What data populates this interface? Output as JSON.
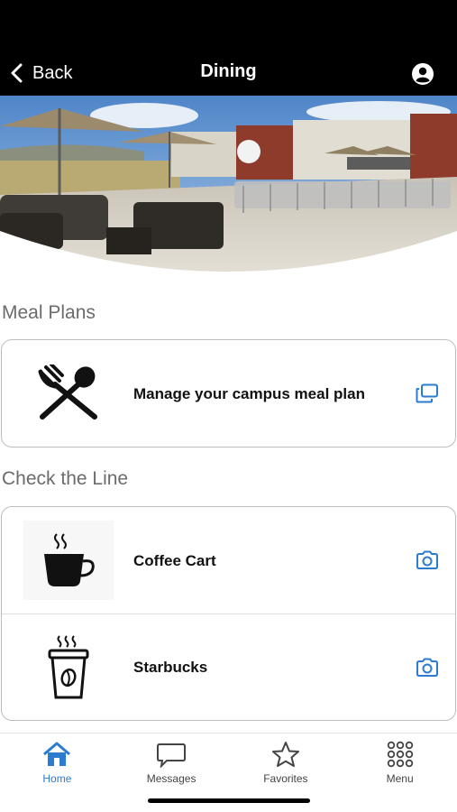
{
  "header": {
    "back_label": "Back",
    "title": "Dining",
    "profile_icon": "user-circle-icon"
  },
  "hero": {
    "alt": "Outdoor rooftop dining patio with umbrellas"
  },
  "meal_plans": {
    "section_title": "Meal Plans",
    "items": [
      {
        "label": "Manage your campus meal plan",
        "icon": "fork-spoon-icon",
        "action_icon": "external-window-icon"
      }
    ]
  },
  "check_line": {
    "section_title": "Check the Line",
    "items": [
      {
        "label": "Coffee Cart",
        "icon": "coffee-cup-icon",
        "action_icon": "camera-icon"
      },
      {
        "label": "Starbucks",
        "icon": "to-go-coffee-icon",
        "action_icon": "camera-icon"
      }
    ]
  },
  "tabbar": {
    "active": "Home",
    "tabs": [
      {
        "label": "Home",
        "icon": "home-icon"
      },
      {
        "label": "Messages",
        "icon": "chat-bubble-icon"
      },
      {
        "label": "Favorites",
        "icon": "star-icon"
      },
      {
        "label": "Menu",
        "icon": "grid-dots-icon"
      }
    ]
  },
  "colors": {
    "accent": "#2b7bd1",
    "header_bg": "#000000",
    "section_text": "#6b6b6b"
  }
}
